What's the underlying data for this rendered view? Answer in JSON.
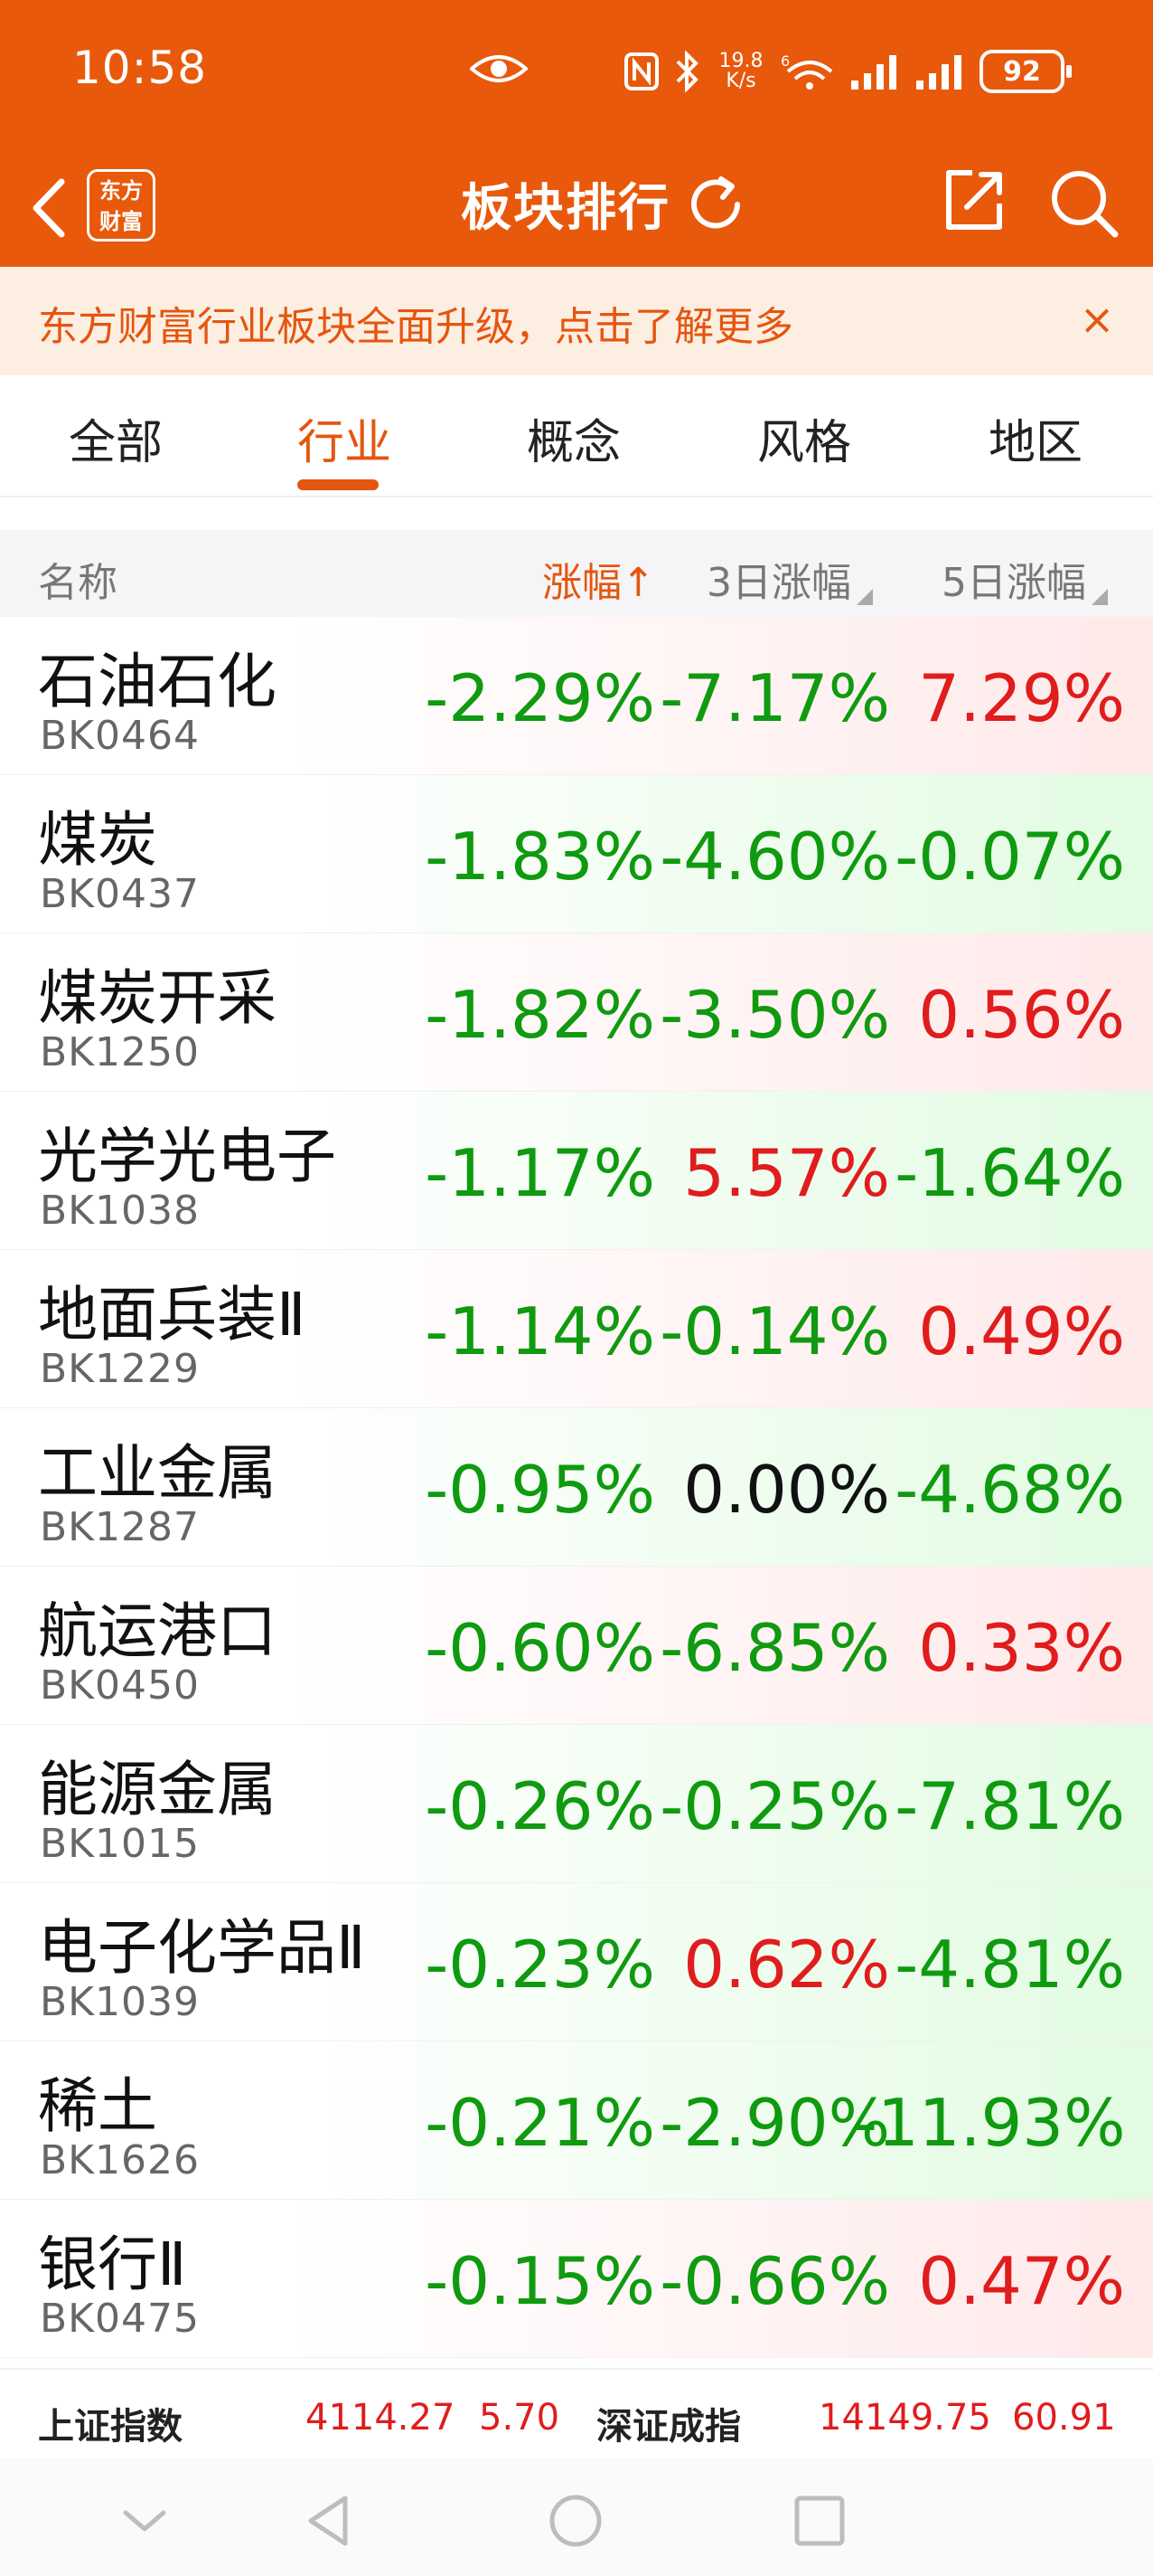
{
  "status": {
    "time": "10:58",
    "net_speed_value": "19.8",
    "net_speed_unit": "K/s",
    "sim": "6",
    "battery": "92"
  },
  "header": {
    "logo_line1": "东方",
    "logo_line2": "财富",
    "title": "板块排行"
  },
  "banner": {
    "text": "东方财富行业板块全面升级，点击了解更多",
    "close": "×"
  },
  "tabs": [
    {
      "label": "全部"
    },
    {
      "label": "行业"
    },
    {
      "label": "概念"
    },
    {
      "label": "风格"
    },
    {
      "label": "地区"
    }
  ],
  "active_tab": "行业",
  "columns": {
    "name": "名称",
    "change": "涨幅↑",
    "change_3d": "3日涨幅",
    "change_5d": "5日涨幅"
  },
  "rows": [
    {
      "name": "石油石化",
      "code": "BK0464",
      "chg": "-2.29%",
      "chg3": "-7.17%",
      "chg5": "7.29%"
    },
    {
      "name": "煤炭",
      "code": "BK0437",
      "chg": "-1.83%",
      "chg3": "-4.60%",
      "chg5": "-0.07%"
    },
    {
      "name": "煤炭开采",
      "code": "BK1250",
      "chg": "-1.82%",
      "chg3": "-3.50%",
      "chg5": "0.56%"
    },
    {
      "name": "光学光电子",
      "code": "BK1038",
      "chg": "-1.17%",
      "chg3": "5.57%",
      "chg5": "-1.64%"
    },
    {
      "name": "地面兵装Ⅱ",
      "code": "BK1229",
      "chg": "-1.14%",
      "chg3": "-0.14%",
      "chg5": "0.49%"
    },
    {
      "name": "工业金属",
      "code": "BK1287",
      "chg": "-0.95%",
      "chg3": "0.00%",
      "chg5": "-4.68%"
    },
    {
      "name": "航运港口",
      "code": "BK0450",
      "chg": "-0.60%",
      "chg3": "-6.85%",
      "chg5": "0.33%"
    },
    {
      "name": "能源金属",
      "code": "BK1015",
      "chg": "-0.26%",
      "chg3": "-0.25%",
      "chg5": "-7.81%"
    },
    {
      "name": "电子化学品Ⅱ",
      "code": "BK1039",
      "chg": "-0.23%",
      "chg3": "0.62%",
      "chg5": "-4.81%"
    },
    {
      "name": "稀土",
      "code": "BK1626",
      "chg": "-0.21%",
      "chg3": "-2.90%",
      "chg5": "-11.93%"
    },
    {
      "name": "银行Ⅱ",
      "code": "BK0475",
      "chg": "-0.15%",
      "chg3": "-0.66%",
      "chg5": "0.47%"
    }
  ],
  "index_bar": {
    "sh_name": "上证指数",
    "sh_value": "4114.27",
    "sh_change": "5.70",
    "sz_name": "深证成指",
    "sz_value": "14149.75",
    "sz_change": "60.91"
  },
  "colors": {
    "brand": "#e8590c",
    "up": "#e01c1c",
    "down": "#0f9a0f"
  },
  "icons": [
    "eye-icon",
    "nfc-icon",
    "bluetooth-icon",
    "wifi-icon",
    "signal-icon",
    "back-icon",
    "refresh-icon",
    "share-icon",
    "search-icon"
  ]
}
